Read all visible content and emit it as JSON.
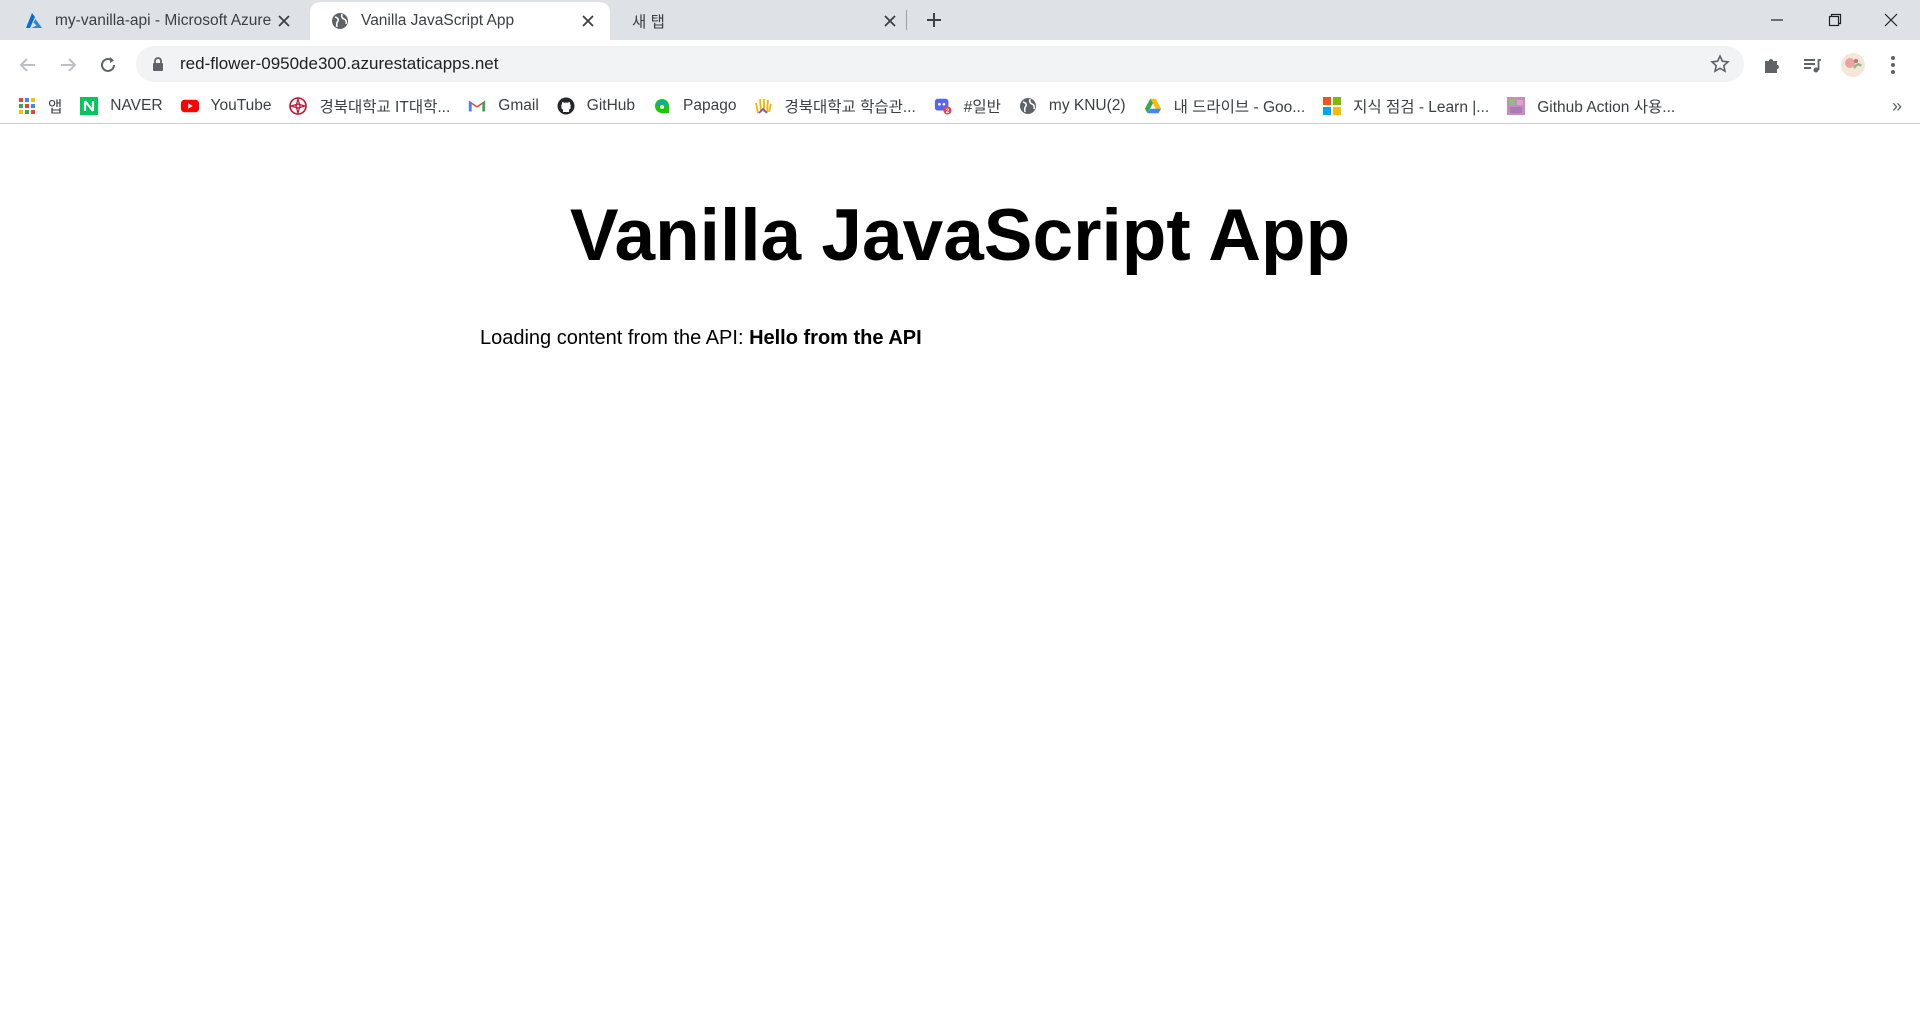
{
  "tabs": [
    {
      "title": "my-vanilla-api - Microsoft Azure",
      "icon": "azure-icon",
      "active": false
    },
    {
      "title": "Vanilla JavaScript App",
      "icon": "globe-icon",
      "active": true
    },
    {
      "title": "새 탭",
      "icon": "",
      "active": false
    }
  ],
  "address_bar": {
    "url": "red-flower-0950de300.azurestaticapps.net"
  },
  "bookmarks": [
    {
      "label": "앱",
      "icon": "apps-grid-icon"
    },
    {
      "label": "NAVER",
      "icon": "naver-icon"
    },
    {
      "label": "YouTube",
      "icon": "youtube-icon"
    },
    {
      "label": "경북대학교 IT대학...",
      "icon": "knu-emblem-icon"
    },
    {
      "label": "Gmail",
      "icon": "gmail-icon"
    },
    {
      "label": "GitHub",
      "icon": "github-icon"
    },
    {
      "label": "Papago",
      "icon": "papago-icon"
    },
    {
      "label": "경북대학교 학습관...",
      "icon": "hand-icon"
    },
    {
      "label": "#일반",
      "icon": "discord-icon"
    },
    {
      "label": "my KNU(2)",
      "icon": "globe-icon"
    },
    {
      "label": "내 드라이브 - Goo...",
      "icon": "google-drive-icon"
    },
    {
      "label": "지식 점검 - Learn |...",
      "icon": "microsoft-icon"
    },
    {
      "label": "Github Action 사용...",
      "icon": "image-thumbnail-icon"
    }
  ],
  "bookmarks_more": "»",
  "page": {
    "heading": "Vanilla JavaScript App",
    "api_prefix": "Loading content from the API: ",
    "api_message": "Hello from the API"
  }
}
